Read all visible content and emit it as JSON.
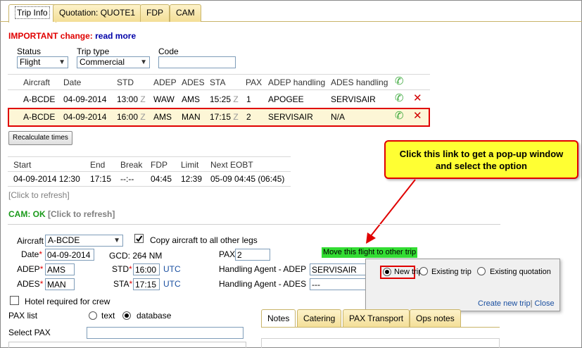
{
  "tabs": [
    "Trip Info",
    "Quotation: QUOTE1",
    "FDP",
    "CAM"
  ],
  "important": {
    "label": "IMPORTANT change:",
    "link": "read more"
  },
  "filters": {
    "status_label": "Status",
    "status_value": "Flight",
    "triptype_label": "Trip type",
    "triptype_value": "Commercial",
    "code_label": "Code",
    "code_value": ""
  },
  "legs": {
    "headers": [
      "Aircraft",
      "Date",
      "STD",
      "ADEP",
      "ADES",
      "STA",
      "PAX",
      "ADEP handling",
      "ADES handling"
    ],
    "rows": [
      {
        "aircraft": "A-BCDE",
        "date": "04-09-2014",
        "std": "13:00",
        "adep": "WAW",
        "ades": "AMS",
        "sta": "15:25",
        "pax": "1",
        "adep_h": "APOGEE",
        "ades_h": "SERVISAIR"
      },
      {
        "aircraft": "A-BCDE",
        "date": "04-09-2014",
        "std": "16:00",
        "adep": "AMS",
        "ades": "MAN",
        "sta": "17:15",
        "pax": "2",
        "adep_h": "SERVISAIR",
        "ades_h": "N/A"
      }
    ],
    "zone": "Z"
  },
  "recalc_label": "Recalculate times",
  "fdp": {
    "headers": [
      "Start",
      "End",
      "Break",
      "FDP",
      "Limit",
      "Next EOBT"
    ],
    "row": [
      "04-09-2014 12:30",
      "17:15",
      "--:--",
      "04:45",
      "12:39",
      "05-09 04:45 (06:45)"
    ]
  },
  "refresh1": "[Click to refresh]",
  "cam": {
    "label": "CAM: OK",
    "refresh": "[Click to refresh]"
  },
  "callout": {
    "line1": "Click this link to get a pop-up window",
    "line2": "and select the option"
  },
  "form": {
    "aircraft_label": "Aircraft",
    "aircraft_value": "A-BCDE",
    "copy_label": "Copy aircraft to all other legs",
    "date_label": "Date",
    "date_value": "04-09-2014",
    "gcd": "GCD: 264 NM",
    "pax_label": "PAX",
    "pax_value": "2",
    "adep_label": "ADEP",
    "adep_value": "AMS",
    "std_label": "STD",
    "std_value": "16:00",
    "ades_label": "ADES",
    "ades_value": "MAN",
    "sta_label": "STA",
    "sta_value": "17:15",
    "utc": "UTC",
    "hadep_label": "Handling Agent - ADEP",
    "hadep_value": "SERVISAIR",
    "hades_label": "Handling Agent - ADES",
    "hades_value": "---",
    "hotel_label": "Hotel required for crew",
    "paxlist_label": "PAX list",
    "text_opt": "text",
    "db_opt": "database",
    "selectpax_label": "Select PAX"
  },
  "move_label": "Move this flight to other trip",
  "popup": {
    "options": [
      "New trip",
      "Existing trip",
      "Existing quotation"
    ],
    "create_link": "Create new trip",
    "sep": "|",
    "close_link": "Close"
  },
  "bottom_tabs": [
    "Notes",
    "Catering",
    "PAX Transport",
    "Ops notes"
  ]
}
